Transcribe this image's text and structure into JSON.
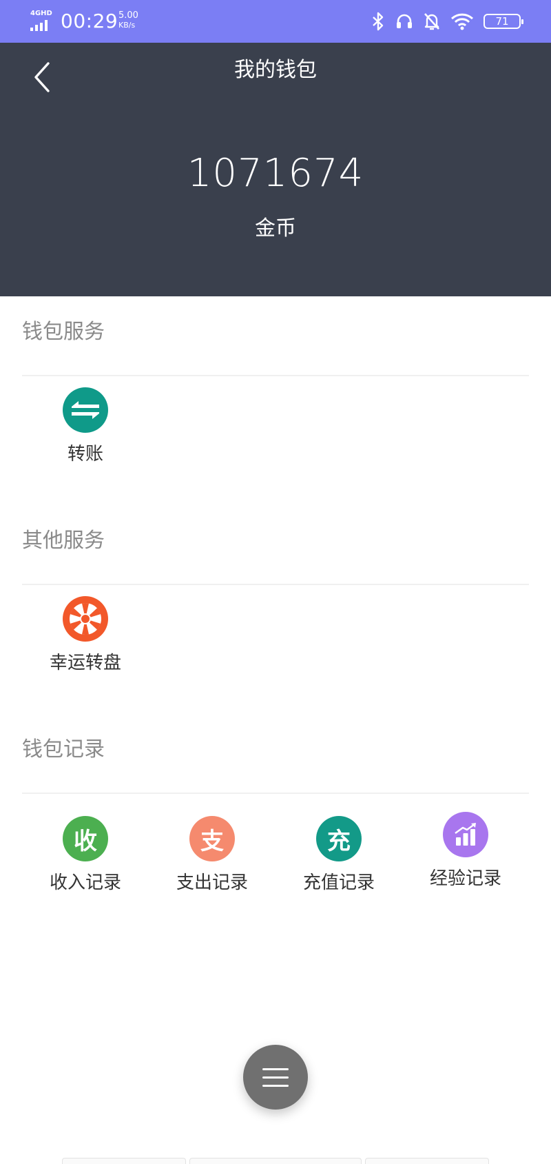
{
  "status_bar": {
    "network": "4GHD",
    "time": "00:29",
    "speed_value": "5.00",
    "speed_unit": "KB/s",
    "battery": "71",
    "icons": [
      "bluetooth-icon",
      "headset-icon",
      "bell-off-icon",
      "wifi-icon",
      "battery-icon"
    ]
  },
  "header": {
    "title": "我的钱包",
    "balance": "1071674",
    "unit": "金币"
  },
  "sections": {
    "wallet_services": {
      "title": "钱包服务",
      "items": [
        {
          "label": "转账",
          "icon": "transfer-icon",
          "color": "#0f9a89"
        }
      ]
    },
    "other_services": {
      "title": "其他服务",
      "items": [
        {
          "label": "幸运转盘",
          "icon": "wheel-icon",
          "color": "#f2582a"
        }
      ]
    },
    "wallet_records": {
      "title": "钱包记录",
      "items": [
        {
          "label": "收入记录",
          "glyph": "收",
          "icon": "income-icon",
          "color": "#4caf50"
        },
        {
          "label": "支出记录",
          "glyph": "支",
          "icon": "expense-icon",
          "color": "#f58a6e"
        },
        {
          "label": "充值记录",
          "glyph": "充",
          "icon": "recharge-icon",
          "color": "#139a88"
        },
        {
          "label": "经验记录",
          "icon": "bar-chart-icon",
          "color": "#a876ee"
        }
      ]
    }
  },
  "fab": {
    "icon": "menu-icon"
  },
  "colors": {
    "status_bar": "#7b7ef4",
    "header_bg": "#3a404d"
  }
}
